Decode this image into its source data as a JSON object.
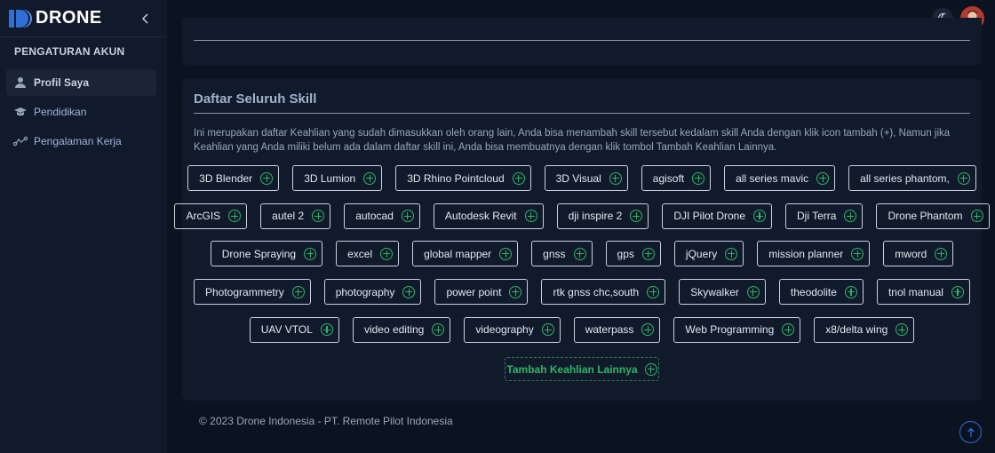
{
  "brand": {
    "name": "DRONE"
  },
  "sidebar": {
    "heading": "PENGATURAN AKUN",
    "items": [
      {
        "label": "Profil Saya",
        "icon": "user-icon",
        "active": true
      },
      {
        "label": "Pendidikan",
        "icon": "graduation-cap-icon",
        "active": false
      },
      {
        "label": "Pengalaman Kerja",
        "icon": "route-icon",
        "active": false
      }
    ]
  },
  "main": {
    "title": "Daftar Seluruh Skill",
    "description": "Ini merupakan daftar Keahlian yang sudah dimasukkan oleh orang lain, Anda bisa menambah skill tersebut kedalam skill Anda dengan klik icon tambah (+), Namun jika Keahlian yang Anda miliki belum ada dalam daftar skill ini, Anda bisa membuatnya dengan klik tombol Tambah Keahlian Lainnya.",
    "skill_rows": [
      [
        "3D Blender",
        "3D Lumion",
        "3D Rhino Pointcloud",
        "3D Visual",
        "agisoft",
        "all series mavic",
        "all series phantom,"
      ],
      [
        "ArcGIS",
        "autel 2",
        "autocad",
        "Autodesk Revit",
        "dji inspire 2",
        "DJI Pilot Drone",
        "Dji Terra",
        "Drone Phantom"
      ],
      [
        "Drone Spraying",
        "excel",
        "global mapper",
        "gnss",
        "gps",
        "jQuery",
        "mission planner",
        "mword"
      ],
      [
        "Photogrammetry",
        "photography",
        "power point",
        "rtk gnss chc,south",
        "Skywalker",
        "theodolite",
        "tnol manual"
      ],
      [
        "UAV VTOL",
        "video editing",
        "videography",
        "waterpass",
        "Web Programming",
        "x8/delta wing"
      ]
    ],
    "add_button": "Tambah Keahlian Lainnya"
  },
  "footer": {
    "text": "© 2023 Drone Indonesia - PT. Remote Pilot Indonesia"
  },
  "colors": {
    "accent_green": "#2fb567",
    "background": "#0b1220",
    "card": "#111a2b",
    "brand_blue": "#2f6fd6"
  }
}
